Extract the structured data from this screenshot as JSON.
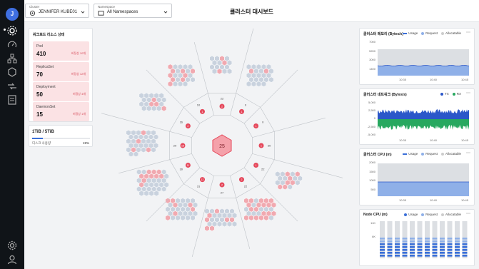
{
  "topbar": {
    "cluster_label": "Cluster",
    "cluster_value": "JENNIFER KUBE01",
    "namespace_label": "Namespace",
    "namespace_value": "All Namespaces",
    "title": "클러스터 대시보드"
  },
  "sidebar": {
    "logo": "J",
    "icons": [
      "settings-icon",
      "gauge-icon",
      "nodes-icon",
      "hexagon-icon",
      "network-icon",
      "report-icon",
      "gear-icon",
      "user-icon"
    ]
  },
  "workload": {
    "title": "워크로드 리소스 상태",
    "items": [
      {
        "name": "Pod",
        "count": "410",
        "abnormal": "비정상 10개"
      },
      {
        "name": "ReplicaSet",
        "count": "70",
        "abnormal": "비정상 12개"
      },
      {
        "name": "Deployment",
        "count": "50",
        "abnormal": "비정상 4개"
      },
      {
        "name": "DaemonSet",
        "count": "15",
        "abnormal": "비정상 1개"
      }
    ]
  },
  "disk": {
    "title": "1TiB / 5TiB",
    "label": "디스크 사용량",
    "percent": "19%",
    "fraction": 0.19
  },
  "hex_map": {
    "center_count": "25",
    "sector_labels": [
      "22",
      "0",
      "0",
      "30",
      "22",
      "22",
      "27",
      "31",
      "30",
      "29",
      "16",
      "10"
    ],
    "sector_badges": [
      "2",
      "1",
      "1",
      "1",
      "1",
      "2",
      "2",
      "12",
      "11",
      "18",
      "2",
      "1"
    ]
  },
  "charts": [
    {
      "title": "클러스터 메모리 (Bytes/s)",
      "legend": [
        "Usage",
        "Request",
        "Allocatable"
      ],
      "y_ticks": [
        "7000",
        "5200",
        "3000",
        "1400"
      ],
      "x_ticks": [
        "10:35",
        "10:40",
        "10:45"
      ]
    },
    {
      "title": "클러스터 네트워크 (Bytes/s)",
      "legend": [
        "TX",
        "RX"
      ],
      "y_ticks": [
        "5,000",
        "2,500",
        "0",
        "-2,500",
        "-5,000"
      ],
      "x_ticks": [
        "10:35",
        "10:40",
        "10:45"
      ]
    },
    {
      "title": "클러스터 CPU (m)",
      "legend": [
        "Usage",
        "Request",
        "Allocatable"
      ],
      "y_ticks": [
        "2000",
        "1500",
        "1000",
        "500"
      ],
      "x_ticks": [
        "10:35",
        "10:40",
        "10:45"
      ]
    },
    {
      "title": "Node CPU (m)",
      "legend": [
        "Usage",
        "Request",
        "Allocatable"
      ],
      "y_ticks": [
        "11K",
        "6K"
      ],
      "x_ticks": []
    }
  ],
  "colors": {
    "accent": "#3a6fd8",
    "alert": "#e5485b",
    "rx": "#27a85f",
    "tx": "#2b57c9",
    "hex_normal": "#c9d2de",
    "hex_alert": "#f1a9b0"
  },
  "more_label": "⋯"
}
